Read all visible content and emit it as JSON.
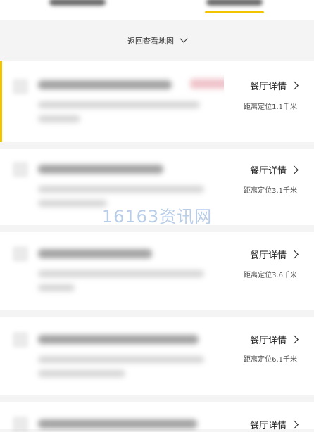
{
  "back_to_map": {
    "label": "返回查看地图"
  },
  "restaurants": [
    {
      "detail_label": "餐厅详情",
      "distance": "距离定位1.1千米",
      "active": true
    },
    {
      "detail_label": "餐厅详情",
      "distance": "距离定位3.1千米",
      "active": false
    },
    {
      "detail_label": "餐厅详情",
      "distance": "距离定位3.6千米",
      "active": false
    },
    {
      "detail_label": "餐厅详情",
      "distance": "距离定位6.1千米",
      "active": false
    },
    {
      "detail_label": "餐厅详情",
      "distance": "",
      "active": false
    }
  ],
  "watermark": "16163资讯网",
  "colors": {
    "accent": "#f2c400",
    "badge": "#e8aab3"
  }
}
